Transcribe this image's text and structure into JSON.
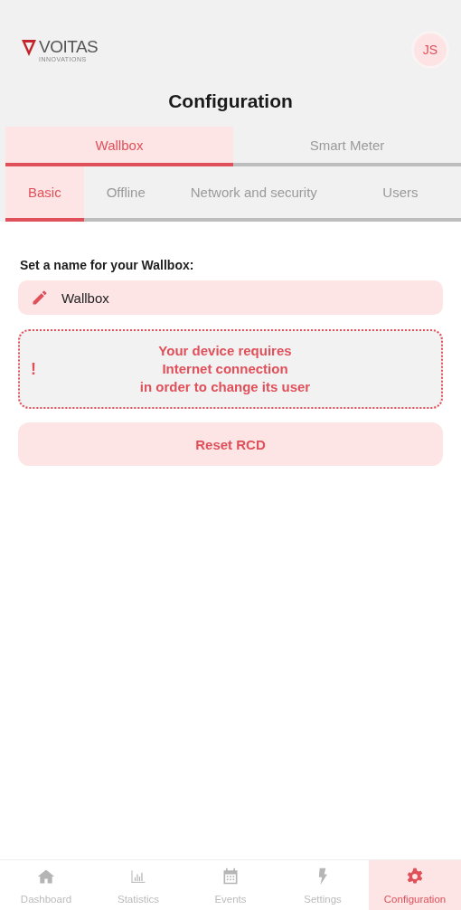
{
  "header": {
    "logo": {
      "name": "VOITAS",
      "tagline": "INNOVATIONS"
    },
    "avatar": "JS",
    "title": "Configuration"
  },
  "tabs": [
    {
      "label": "Wallbox",
      "selected": true
    },
    {
      "label": "Smart Meter",
      "selected": false
    }
  ],
  "subtabs": [
    {
      "label": "Basic",
      "selected": true
    },
    {
      "label": "Offline",
      "selected": false
    },
    {
      "label": "Network and security",
      "selected": false
    },
    {
      "label": "Users",
      "selected": false
    }
  ],
  "name_field": {
    "label": "Set a name for your Wallbox:",
    "value": "Wallbox"
  },
  "warning": {
    "icon": "!",
    "lines": [
      "Your device requires",
      "Internet connection",
      "in order to change its user"
    ]
  },
  "reset_button": "Reset RCD",
  "bottom_nav": [
    {
      "kind": "home",
      "label": "Dashboard",
      "selected": false
    },
    {
      "kind": "chart",
      "label": "Statistics",
      "selected": false
    },
    {
      "kind": "calendar",
      "label": "Events",
      "selected": false
    },
    {
      "kind": "bolt",
      "label": "Settings",
      "selected": false
    },
    {
      "kind": "gear",
      "label": "Configuration",
      "selected": true
    }
  ]
}
